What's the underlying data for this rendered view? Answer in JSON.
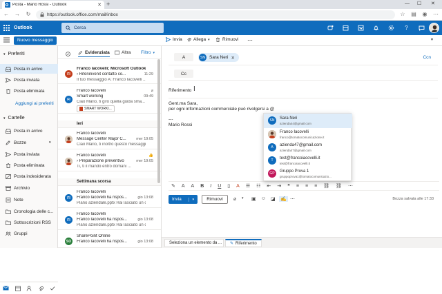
{
  "browser": {
    "tab_title": "Posta - Mario Rossi - Outlook",
    "url": "https://outlook.office.com/mail/inbox",
    "new_tab": "+"
  },
  "suite": {
    "app_name": "Outlook",
    "search_placeholder": "Cerca",
    "accent": "#0f6cbd"
  },
  "commands": {
    "new_message": "Nuovo messaggio",
    "send": "Invia",
    "attach": "Allega",
    "discard": "Rimuovi"
  },
  "nav": {
    "favorites_header": "Preferiti",
    "favorites": [
      {
        "label": "Posta in arrivo",
        "icon": "inbox-icon"
      },
      {
        "label": "Posta inviata",
        "icon": "send-icon"
      },
      {
        "label": "Posta eliminata",
        "icon": "trash-icon"
      }
    ],
    "add_favorites": "Aggiungi ai preferiti",
    "folders_header": "Cartelle",
    "folders": [
      {
        "label": "Posta in arrivo",
        "icon": "inbox-icon"
      },
      {
        "label": "Bozze",
        "icon": "pencil-icon"
      },
      {
        "label": "Posta inviata",
        "icon": "send-icon"
      },
      {
        "label": "Posta eliminata",
        "icon": "trash-icon"
      },
      {
        "label": "Posta indesiderata",
        "icon": "junk-icon"
      },
      {
        "label": "Archivio",
        "icon": "archive-icon"
      },
      {
        "label": "Note",
        "icon": "note-icon"
      },
      {
        "label": "Cronologia delle c...",
        "icon": "folder-icon"
      },
      {
        "label": "Sottoscrizioni RSS",
        "icon": "folder-icon"
      },
      {
        "label": "Gruppi",
        "icon": "group-icon"
      }
    ]
  },
  "list": {
    "tab_focused": "Evidenziata",
    "tab_other": "Altra",
    "filter": "Filtro",
    "section_yesterday": "Ieri",
    "section_lastweek": "Settimana scorsa",
    "messages": [
      {
        "from": "Franco Iacovelli; Microsoft Outlook",
        "subject": "Rifeninvenit contatto co...",
        "preview": "Il tuo messaggio A: Franco Iacovelli ...",
        "time": "11:29",
        "initials": "FI",
        "color": "#c43e1c"
      },
      {
        "from": "Franco Iacovelli",
        "subject": "Smart working",
        "preview": "Ciao Mario, ti giro quella guida sma...",
        "time": "09:49",
        "initials": "FI",
        "color": "#0f6cbd",
        "attachment": "SMART WORKI..."
      },
      {
        "from": "Franco Iacovelli",
        "subject": "Message Center Major C...",
        "preview": "Ciao Mario, ti inoltro questo messaggio ...",
        "time": "mer 19:05",
        "initials": "FI",
        "color": "#c43e1c"
      },
      {
        "from": "Franco Iacovelli",
        "subject": "Preparazione preventivo",
        "preview": "Ti, ti il mando entro domani ...",
        "time": "mer 19:05",
        "initials": "FI",
        "color": "#c43e1c"
      },
      {
        "from": "Franco Iacovelli",
        "subject": "Franco Iacovelli ha rispos...",
        "preview": "Piano aziendale.pptx Hai lasciato un com...",
        "time": "gio 13:08",
        "initials": "FI",
        "color": "#0f6cbd"
      },
      {
        "from": "Franco Iacovelli",
        "subject": "Franco Iacovelli ha rispos...",
        "preview": "Piano aziendale.pptx Hai lasciato un com...",
        "time": "gio 13:08",
        "initials": "FI",
        "color": "#0f6cbd"
      },
      {
        "from": "SharePoint Online",
        "subject": "Franco Iacovelli ha rispos...",
        "preview": "",
        "time": "gio 13:08",
        "initials": "SO",
        "color": "#2a7f3b"
      }
    ]
  },
  "compose": {
    "to_label": "A",
    "cc_label": "Cc",
    "bcc_label": "Ccn",
    "recipient_initials": "SN",
    "recipient_name": "Sara Neri",
    "subject_label": "Riferimento",
    "body_line1": "Gent.ma Sara,",
    "body_line2": "per ogni informazioni commerciale può rivolgersi a @",
    "body_line3": "---",
    "body_line4": "Mario Rossi",
    "send": "Invia",
    "discard": "Rimuovi",
    "saved_status": "Bozza salvata alle 17:33"
  },
  "suggestions": [
    {
      "initials": "SN",
      "name": "Sara Neri",
      "email": "azienda44@gmail.com",
      "color": "#0f6cbd"
    },
    {
      "initials": "FI",
      "name": "Franco Iacovelli",
      "email": "franco@tomatocomunicazione.it",
      "color": "#8a6d4f"
    },
    {
      "initials": "A",
      "name": "azienda47@gmail.com",
      "email": "azienda47@gmail.com",
      "color": "#0f6cbd"
    },
    {
      "initials": "T",
      "name": "test@francoiacovelli.it",
      "email": "test@francoiacovelli.it",
      "color": "#0f6cbd"
    },
    {
      "initials": "GP",
      "name": "Gruppo Prova 1",
      "email": "gruppoprova1@tomatocomunicazio...",
      "color": "#c2185b"
    }
  ],
  "bottom_tabs": {
    "tab1": "Seleziona un elemento da ...",
    "tab2": "Riferimento"
  }
}
